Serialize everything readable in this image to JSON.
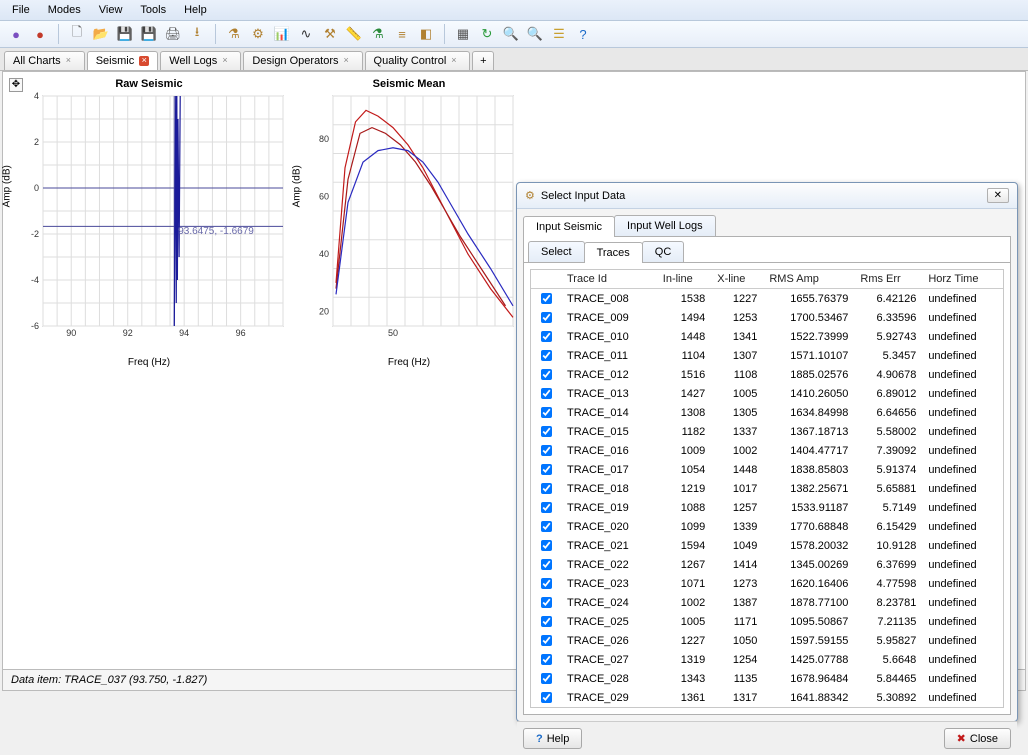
{
  "menu": [
    "File",
    "Modes",
    "View",
    "Tools",
    "Help"
  ],
  "toolbar_icons": [
    {
      "name": "sphere-purple-icon",
      "glyph": "●",
      "color": "#7a4fc0"
    },
    {
      "name": "sphere-red-icon",
      "glyph": "●",
      "color": "#c23a2a"
    },
    {
      "sep": true
    },
    {
      "name": "new-doc-icon",
      "glyph": "🗋",
      "color": "#666"
    },
    {
      "name": "open-folder-icon",
      "glyph": "📂",
      "color": "#d8a43a"
    },
    {
      "name": "save-icon",
      "glyph": "💾",
      "color": "#3a5fc0"
    },
    {
      "name": "save-all-icon",
      "glyph": "💾",
      "color": "#6a3fc0"
    },
    {
      "name": "print-icon",
      "glyph": "🖨",
      "color": "#555"
    },
    {
      "name": "export-icon",
      "glyph": "⭳",
      "color": "#b08030"
    },
    {
      "sep": true
    },
    {
      "name": "wizard-icon",
      "glyph": "⚗",
      "color": "#b08030"
    },
    {
      "name": "gears-icon",
      "glyph": "⚙",
      "color": "#b08030"
    },
    {
      "name": "chart-icon",
      "glyph": "📊",
      "color": "#3a5fc0"
    },
    {
      "name": "waveform-icon",
      "glyph": "∿",
      "color": "#333"
    },
    {
      "name": "sliders-icon",
      "glyph": "⚒",
      "color": "#b08030"
    },
    {
      "name": "ruler-icon",
      "glyph": "📏",
      "color": "#b08030"
    },
    {
      "name": "flask-icon",
      "glyph": "⚗",
      "color": "#2a8a3a"
    },
    {
      "name": "layers-icon",
      "glyph": "≡",
      "color": "#b08030"
    },
    {
      "name": "cube-icon",
      "glyph": "◧",
      "color": "#b08030"
    },
    {
      "sep": true
    },
    {
      "name": "grid-icon",
      "glyph": "▦",
      "color": "#555"
    },
    {
      "name": "refresh-icon",
      "glyph": "↻",
      "color": "#2a9a3a"
    },
    {
      "name": "zoom-in-icon",
      "glyph": "🔍",
      "color": "#2a9a3a"
    },
    {
      "name": "zoom-out-icon",
      "glyph": "🔍",
      "color": "#2a9a3a"
    },
    {
      "name": "stack-icon",
      "glyph": "☰",
      "color": "#c8a030"
    },
    {
      "name": "help-icon",
      "glyph": "?",
      "color": "#1a6ac8"
    }
  ],
  "doc_tabs": [
    {
      "label": "All Charts",
      "active": false,
      "closable": true
    },
    {
      "label": "Seismic",
      "active": true,
      "closable": true,
      "red_close": true
    },
    {
      "label": "Well Logs",
      "active": false,
      "closable": true
    },
    {
      "label": "Design Operators",
      "active": false,
      "closable": true
    },
    {
      "label": "Quality Control",
      "active": false,
      "closable": true
    }
  ],
  "chart_data": [
    {
      "type": "line",
      "title": "Raw Seismic",
      "xlabel": "Freq (Hz)",
      "ylabel": "Amp (dB)",
      "xlim": [
        89,
        97.5
      ],
      "ylim": [
        -6,
        4
      ],
      "xticks": [
        90,
        92,
        94,
        96
      ],
      "yticks": [
        -6,
        -4,
        -2,
        0,
        2,
        4
      ],
      "cursor": {
        "x": 93.6475,
        "y": -1.6679,
        "label": "93.6475, -1.6679"
      },
      "series": [
        {
          "name": "trace",
          "color": "#1a1a9a",
          "x": [
            93.65,
            93.7,
            93.72,
            93.74,
            93.76,
            93.78,
            93.82,
            93.86
          ],
          "y": [
            -6,
            4,
            -5,
            4,
            -4,
            3,
            -3,
            4
          ]
        }
      ]
    },
    {
      "type": "line",
      "title": "Seismic Mean",
      "xlabel": "Freq (Hz)",
      "ylabel": "Amp (dB)",
      "xlim": [
        10,
        130
      ],
      "ylim": [
        15,
        95
      ],
      "xticks": [
        50
      ],
      "yticks": [
        20,
        40,
        60,
        80
      ],
      "series": [
        {
          "name": "mean-red1",
          "color": "#c21a1a",
          "x": [
            12,
            18,
            25,
            32,
            40,
            50,
            60,
            70,
            80,
            90,
            100,
            115,
            130
          ],
          "y": [
            30,
            70,
            86,
            90,
            88,
            84,
            78,
            70,
            60,
            50,
            40,
            28,
            18
          ]
        },
        {
          "name": "mean-red2",
          "color": "#a81a1a",
          "x": [
            12,
            20,
            28,
            36,
            45,
            55,
            65,
            75,
            85,
            95,
            110,
            125
          ],
          "y": [
            28,
            66,
            82,
            84,
            82,
            78,
            72,
            64,
            55,
            46,
            34,
            22
          ]
        },
        {
          "name": "mean-blue",
          "color": "#2a2ac0",
          "x": [
            12,
            20,
            30,
            40,
            50,
            60,
            70,
            80,
            90,
            100,
            115,
            130
          ],
          "y": [
            26,
            58,
            72,
            76,
            77,
            76,
            72,
            65,
            56,
            47,
            35,
            22
          ]
        }
      ]
    }
  ],
  "status_text": "Data item: TRACE_037 (93.750, -1.827)",
  "dialog": {
    "title": "Select Input Data",
    "outer_tabs": [
      "Input Seismic",
      "Input Well Logs"
    ],
    "outer_active": 0,
    "inner_tabs": [
      "Select",
      "Traces",
      "QC"
    ],
    "inner_active": 1,
    "columns": [
      "Trace Id",
      "In-line",
      "X-line",
      "RMS Amp",
      "Rms Err",
      "Horz Time"
    ],
    "rows": [
      {
        "id": "TRACE_008",
        "inline": 1538,
        "xline": 1227,
        "rms": "1655.76379",
        "err": "6.42126",
        "horz": "undefined"
      },
      {
        "id": "TRACE_009",
        "inline": 1494,
        "xline": 1253,
        "rms": "1700.53467",
        "err": "6.33596",
        "horz": "undefined"
      },
      {
        "id": "TRACE_010",
        "inline": 1448,
        "xline": 1341,
        "rms": "1522.73999",
        "err": "5.92743",
        "horz": "undefined"
      },
      {
        "id": "TRACE_011",
        "inline": 1104,
        "xline": 1307,
        "rms": "1571.10107",
        "err": "5.3457",
        "horz": "undefined"
      },
      {
        "id": "TRACE_012",
        "inline": 1516,
        "xline": 1108,
        "rms": "1885.02576",
        "err": "4.90678",
        "horz": "undefined"
      },
      {
        "id": "TRACE_013",
        "inline": 1427,
        "xline": 1005,
        "rms": "1410.26050",
        "err": "6.89012",
        "horz": "undefined"
      },
      {
        "id": "TRACE_014",
        "inline": 1308,
        "xline": 1305,
        "rms": "1634.84998",
        "err": "6.64656",
        "horz": "undefined"
      },
      {
        "id": "TRACE_015",
        "inline": 1182,
        "xline": 1337,
        "rms": "1367.18713",
        "err": "5.58002",
        "horz": "undefined"
      },
      {
        "id": "TRACE_016",
        "inline": 1009,
        "xline": 1002,
        "rms": "1404.47717",
        "err": "7.39092",
        "horz": "undefined"
      },
      {
        "id": "TRACE_017",
        "inline": 1054,
        "xline": 1448,
        "rms": "1838.85803",
        "err": "5.91374",
        "horz": "undefined"
      },
      {
        "id": "TRACE_018",
        "inline": 1219,
        "xline": 1017,
        "rms": "1382.25671",
        "err": "5.65881",
        "horz": "undefined"
      },
      {
        "id": "TRACE_019",
        "inline": 1088,
        "xline": 1257,
        "rms": "1533.91187",
        "err": "5.7149",
        "horz": "undefined"
      },
      {
        "id": "TRACE_020",
        "inline": 1099,
        "xline": 1339,
        "rms": "1770.68848",
        "err": "6.15429",
        "horz": "undefined"
      },
      {
        "id": "TRACE_021",
        "inline": 1594,
        "xline": 1049,
        "rms": "1578.20032",
        "err": "10.9128",
        "horz": "undefined"
      },
      {
        "id": "TRACE_022",
        "inline": 1267,
        "xline": 1414,
        "rms": "1345.00269",
        "err": "6.37699",
        "horz": "undefined"
      },
      {
        "id": "TRACE_023",
        "inline": 1071,
        "xline": 1273,
        "rms": "1620.16406",
        "err": "4.77598",
        "horz": "undefined"
      },
      {
        "id": "TRACE_024",
        "inline": 1002,
        "xline": 1387,
        "rms": "1878.77100",
        "err": "8.23781",
        "horz": "undefined"
      },
      {
        "id": "TRACE_025",
        "inline": 1005,
        "xline": 1171,
        "rms": "1095.50867",
        "err": "7.21135",
        "horz": "undefined"
      },
      {
        "id": "TRACE_026",
        "inline": 1227,
        "xline": 1050,
        "rms": "1597.59155",
        "err": "5.95827",
        "horz": "undefined"
      },
      {
        "id": "TRACE_027",
        "inline": 1319,
        "xline": 1254,
        "rms": "1425.07788",
        "err": "5.6648",
        "horz": "undefined"
      },
      {
        "id": "TRACE_028",
        "inline": 1343,
        "xline": 1135,
        "rms": "1678.96484",
        "err": "5.84465",
        "horz": "undefined"
      },
      {
        "id": "TRACE_029",
        "inline": 1361,
        "xline": 1317,
        "rms": "1641.88342",
        "err": "5.30892",
        "horz": "undefined"
      }
    ],
    "help_label": "Help",
    "close_label": "Close"
  }
}
